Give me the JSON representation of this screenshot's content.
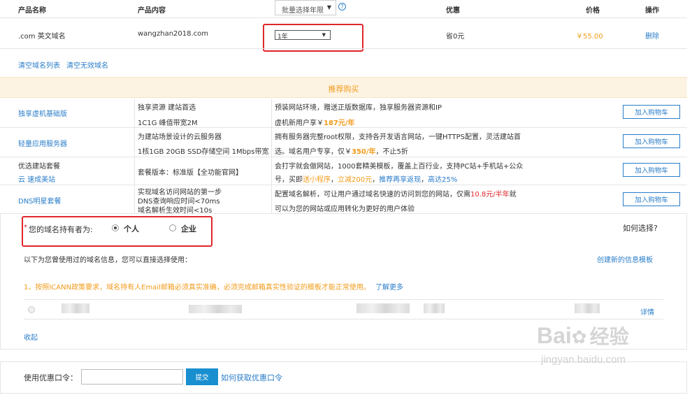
{
  "table_header": {
    "product_name": "产品名称",
    "product_content": "产品内容",
    "batch_select": "批量选择年限",
    "discount": "优惠",
    "price": "价格",
    "action": "操作"
  },
  "cart_item": {
    "name": ".com 英文域名",
    "content": "wangzhan2018.com",
    "years_selected": "1年",
    "discount": "省0元",
    "price": "￥55.00",
    "delete_label": "删除"
  },
  "links": {
    "clear_list": "清空域名列表",
    "clear_invalid": "清空无效域名"
  },
  "recommend": {
    "title": "推荐购买",
    "button_label": "加入购物车",
    "items": [
      {
        "name": "独享虚机基础版",
        "spec1": "独享资源 建站首选",
        "spec2": "1C1G 峰值带宽2M",
        "desc1": "预装网站环境，赠送正版数据库，独享服务器资源和IP",
        "desc2a": "虚机新用户享￥",
        "desc2b": "187元/年"
      },
      {
        "name": "轻量应用服务器",
        "spec1": "为建站场景设计的云服务器",
        "spec2": "1核1GB 20GB SSD存储空间 1Mbps带宽",
        "desc1": "拥有服务器完整root权限，支持各开发语言网站，一键HTTPS配置，灵活建站首",
        "desc2a": "选。域名用户专享，仅￥",
        "desc2b": "350/年",
        "desc2c": "，不止5折"
      },
      {
        "name1": "优选建站套餐",
        "name2": "云 速成美站",
        "spec1": "套餐版本：标准版【全功能官网】",
        "desc1": "会打字就会做网站，1000套精美模板，覆盖上百行业，支持PC站+手机站+公众",
        "desc2a": "号，买即",
        "desc2b": "送小程序",
        "desc2c": "，",
        "desc2d": "立减200元",
        "desc2e": "，",
        "desc2f": "推荐再享返现",
        "desc2g": "，",
        "desc2h": "高达25%"
      },
      {
        "name": "DNS明星套餐",
        "spec1": "实现域名访问网站的第一步",
        "spec2": "DNS查询响应时间<70ms",
        "spec3": "域名解析生效时间<10s",
        "desc1a": "配置域名解析，可让用户通过域名快速的访问到您的网站，仅需",
        "desc1b": "10.8元/半年",
        "desc1c": "就",
        "desc2": "可以为您的网站或应用转化为更好的用户体验"
      }
    ]
  },
  "owner": {
    "asterisk": "*",
    "label": "您的域名持有者为:",
    "option_personal": "个人",
    "option_company": "企业",
    "how_to_choose": "如何选择?",
    "used_info_text": "以下为您曾使用过的域名信息，您可以直接选择使用：",
    "create_template": "创建新的信息模板",
    "icann_notice": "1、按照ICANN政策要求，域名持有人Email邮箱必须真实准确，必须完成邮箱真实性验证的模板才能正常使用。",
    "learn_more": "了解更多",
    "details": "详情",
    "collapse": "收起"
  },
  "coupon": {
    "label": "使用优惠口令：",
    "submit": "提交",
    "how_to_get": "如何获取优惠口令"
  },
  "watermark": {
    "brand": "Bai",
    "brand2": "经验",
    "url": "jingyan.baidu.com"
  },
  "colors": {
    "link": "#2a7dc9",
    "orange": "#f29b1b",
    "red": "#e0262c",
    "banner_bg": "#fdf3e3",
    "submit_bg": "#1a8fd0"
  }
}
